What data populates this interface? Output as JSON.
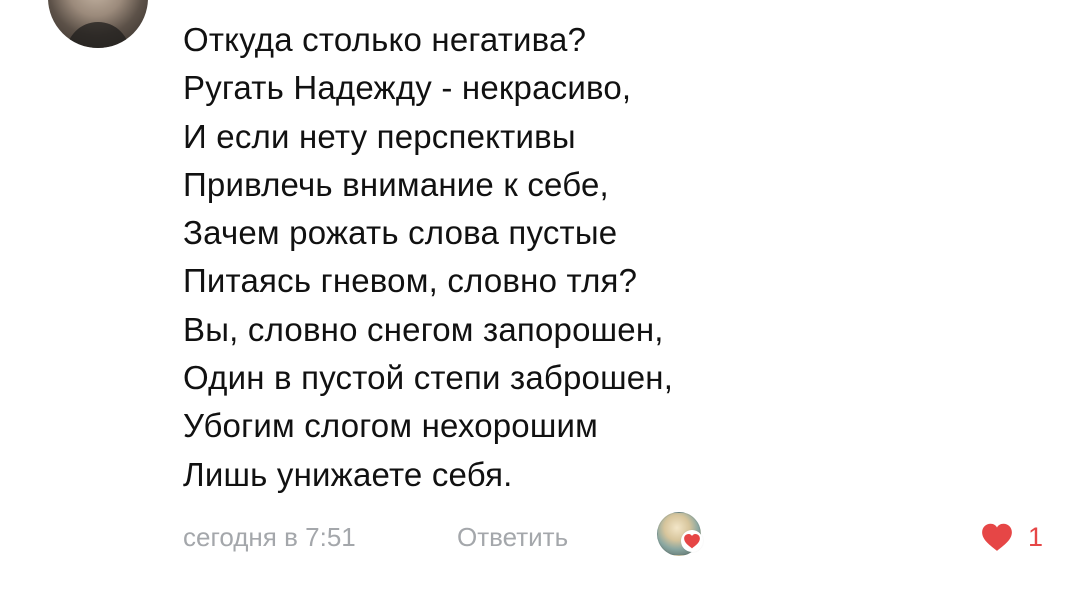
{
  "comment": {
    "lines": [
      "Откуда столько негатива?",
      "Ругать Надежду - некрасиво,",
      "И если нету перспективы",
      "Привлечь внимание к себе,",
      "Зачем рожать слова пустые",
      "Питаясь гневом, словно тля?",
      "Вы, словно снегом запорошен,",
      "Один в пустой степи заброшен,",
      "Убогим слогом нехорошим",
      "Лишь унижаете себя."
    ]
  },
  "footer": {
    "timestamp": "сегодня в 7:51",
    "reply_label": "Ответить",
    "likes_count": "1"
  },
  "icons": {
    "commenter_avatar": "avatar-photo",
    "liker_avatar": "avatar-photo",
    "liker_badge": "heart-icon",
    "like_button": "heart-icon"
  },
  "colors": {
    "text": "#111111",
    "meta": "#a4a7ab",
    "like_red": "#e64646"
  }
}
